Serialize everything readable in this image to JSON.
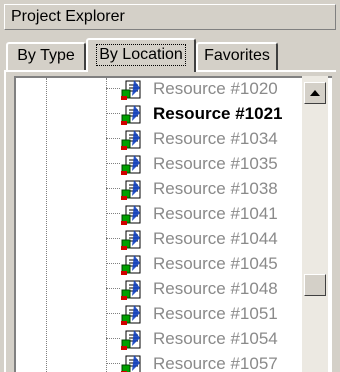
{
  "panel": {
    "title": "Project Explorer"
  },
  "tabs": [
    {
      "label": "By Type",
      "selected": false
    },
    {
      "label": "By Location",
      "selected": true
    },
    {
      "label": "Favorites",
      "selected": false
    }
  ],
  "tree": {
    "items": [
      {
        "label": "Resource #1020",
        "bold": false
      },
      {
        "label": "Resource #1021",
        "bold": true
      },
      {
        "label": "Resource #1034",
        "bold": false
      },
      {
        "label": "Resource #1035",
        "bold": false
      },
      {
        "label": "Resource #1038",
        "bold": false
      },
      {
        "label": "Resource #1041",
        "bold": false
      },
      {
        "label": "Resource #1044",
        "bold": false
      },
      {
        "label": "Resource #1045",
        "bold": false
      },
      {
        "label": "Resource #1048",
        "bold": false
      },
      {
        "label": "Resource #1051",
        "bold": false
      },
      {
        "label": "Resource #1054",
        "bold": false
      },
      {
        "label": "Resource #1057",
        "bold": false
      }
    ],
    "item_icon": "resource-document-icon"
  },
  "colors": {
    "dialog_face": "#d4d0c8",
    "tree_background": "#ffffff",
    "dimmed_text": "#8a8a8a",
    "active_text": "#000000"
  }
}
